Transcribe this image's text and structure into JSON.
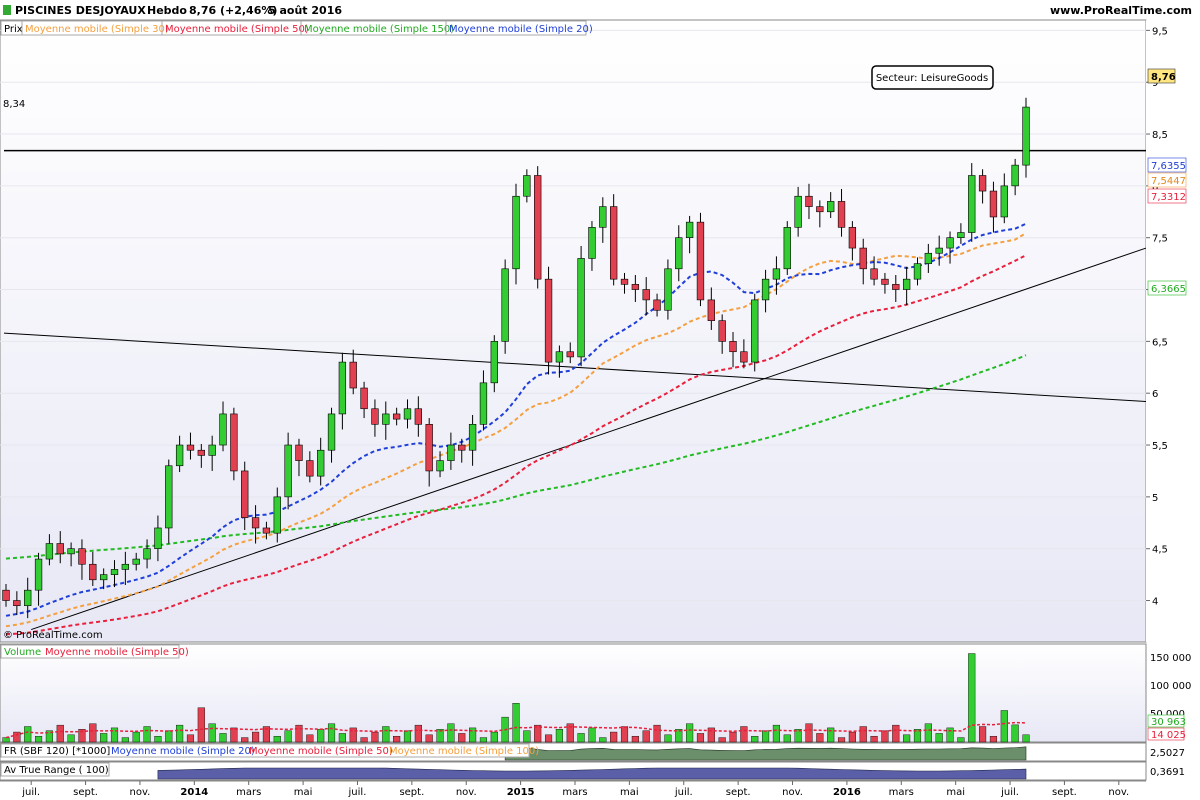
{
  "header": {
    "title": "PISCINES DESJOYAUX",
    "period": "Hebdo",
    "last_change": "8,76 (+2,46%)",
    "date": "5 août 2016",
    "website": "www.ProRealTime.com",
    "copyright": "© ProRealTime.com"
  },
  "legend": {
    "price_label": "Prix",
    "ma30": "Moyenne mobile (Simple 30)",
    "ma50": "Moyenne mobile (Simple 50)",
    "ma150": "Moyenne mobile (Simple 150)",
    "ma20": "Moyenne mobile (Simple 20)"
  },
  "annotations": {
    "sector": "Secteur: LeisureGoods",
    "resistance_label": "8,34"
  },
  "value_badges": {
    "last": "8,76",
    "ma20": "7,6355",
    "ma30": "7,5447",
    "ma50": "7,3312",
    "ma150": "6,3665"
  },
  "volume_panel": {
    "label_volume": "Volume",
    "label_ma": "Moyenne mobile (Simple 50)",
    "badge_last": "30 963",
    "badge_ma": "14 025",
    "ticks": [
      "150 000",
      "100 000",
      "50 000"
    ]
  },
  "rs_panel": {
    "label": "FR (SBF 120) [*1000]",
    "ma20": "Moyenne mobile (Simple 20)",
    "ma50": "Moyenne mobile (Simple 50)",
    "ma100": "Moyenne mobile (Simple 100)",
    "badge": "2,5027"
  },
  "atr_panel": {
    "label": "Av True Range ( 100)",
    "badge": "0,3691"
  },
  "x_axis_labels": [
    "juil.",
    "sept.",
    "nov.",
    "2014",
    "mars",
    "mai",
    "juil.",
    "sept.",
    "nov.",
    "2015",
    "mars",
    "mai",
    "juil.",
    "sept.",
    "nov.",
    "2016",
    "mars",
    "mai",
    "juil.",
    "sept.",
    "nov."
  ],
  "colors": {
    "up": "#33cc33",
    "down": "#e04050",
    "ma20": "#1f3fd8",
    "ma30": "#f4a040",
    "ma50": "#e8203c",
    "ma150": "#22bb22",
    "badge_last": "#ffe680"
  },
  "chart_data": {
    "type": "candlestick",
    "title": "PISCINES DESJOYAUX",
    "period": "weekly",
    "y_ticks": [
      "9,5",
      "9",
      "8,5",
      "8",
      "7,5",
      "7",
      "6,5",
      "6",
      "5,5",
      "5",
      "4,5",
      "4"
    ],
    "ylim": [
      3.6,
      9.6
    ],
    "x_range": [
      "2013-06",
      "2016-12"
    ],
    "trendlines": [
      {
        "name": "resistance",
        "points": [
          [
            "2013-06",
            8.34
          ],
          [
            "2016-12",
            8.34
          ]
        ]
      },
      {
        "name": "descending",
        "points": [
          [
            "2013-06",
            6.58
          ],
          [
            "2016-12",
            5.92
          ]
        ]
      },
      {
        "name": "ascending",
        "points": [
          [
            "2013-07",
            3.72
          ],
          [
            "2016-12",
            7.4
          ]
        ]
      }
    ],
    "closes": [
      4.0,
      3.95,
      4.1,
      4.4,
      4.55,
      4.45,
      4.5,
      4.35,
      4.2,
      4.25,
      4.3,
      4.35,
      4.4,
      4.5,
      4.7,
      5.3,
      5.5,
      5.45,
      5.4,
      5.5,
      5.8,
      5.25,
      4.8,
      4.7,
      4.65,
      5.0,
      5.5,
      5.35,
      5.2,
      5.45,
      5.8,
      6.3,
      6.05,
      5.85,
      5.7,
      5.8,
      5.75,
      5.85,
      5.7,
      5.25,
      5.35,
      5.5,
      5.45,
      5.7,
      6.1,
      6.5,
      7.2,
      7.9,
      8.1,
      7.1,
      6.3,
      6.4,
      6.35,
      7.3,
      7.6,
      7.8,
      7.1,
      7.05,
      7.0,
      6.9,
      6.8,
      7.2,
      7.5,
      7.65,
      6.9,
      6.7,
      6.5,
      6.4,
      6.3,
      6.9,
      7.1,
      7.2,
      7.6,
      7.9,
      7.8,
      7.75,
      7.85,
      7.6,
      7.4,
      7.2,
      7.1,
      7.05,
      7.0,
      7.1,
      7.25,
      7.35,
      7.4,
      7.5,
      7.55,
      8.1,
      7.95,
      7.7,
      8.0,
      8.2,
      8.76
    ],
    "series": [
      {
        "name": "Moyenne mobile (Simple 20)",
        "last": 7.6355
      },
      {
        "name": "Moyenne mobile (Simple 30)",
        "last": 7.5447
      },
      {
        "name": "Moyenne mobile (Simple 50)",
        "last": 7.3312
      },
      {
        "name": "Moyenne mobile (Simple 150)",
        "last": 6.3665
      }
    ],
    "volume": {
      "ylim": [
        0,
        170000
      ],
      "max_spike": 160000,
      "last": 30963,
      "ma_last": 14025
    }
  }
}
